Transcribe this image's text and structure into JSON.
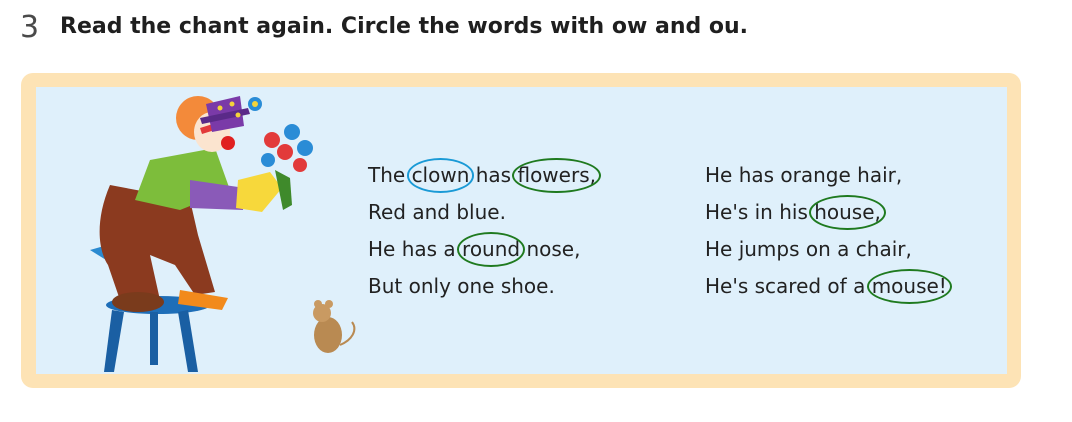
{
  "exercise": {
    "number": "3",
    "instruction": "Read the chant again. Circle the words with ow and ou."
  },
  "colors": {
    "frame": "#fde3b5",
    "panel": "#dff0fb",
    "circle_example": "#1a9ad6",
    "circle_answer": "#1f7a1f"
  },
  "illustration": {
    "clown": "clown-with-flowers-on-stool",
    "mouse": "mouse"
  },
  "verse1": {
    "l1_a": "The ",
    "l1_w1": "clown",
    "l1_b": " has ",
    "l1_w2": "flowers,",
    "l2": "Red and blue.",
    "l3_a": "He has a ",
    "l3_w": "round",
    "l3_b": " nose,",
    "l4": "But only one shoe."
  },
  "verse2": {
    "l1": "He has orange hair,",
    "l2_a": "He's in his ",
    "l2_w": "house,",
    "l3": "He jumps on a chair,",
    "l4_a": "He's scared of a ",
    "l4_w": "mouse!"
  }
}
